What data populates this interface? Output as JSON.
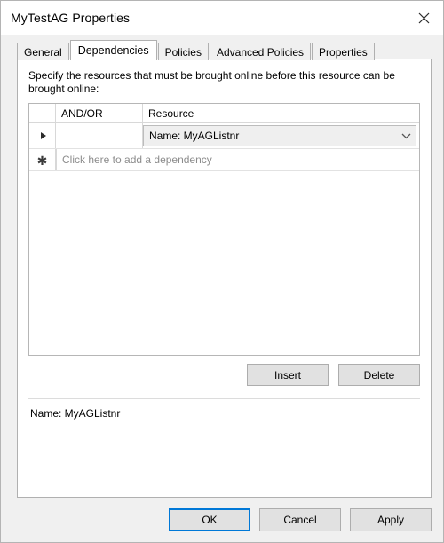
{
  "window": {
    "title": "MyTestAG Properties",
    "close_label": "✕"
  },
  "tabs": [
    {
      "label": "General",
      "active": false
    },
    {
      "label": "Dependencies",
      "active": true
    },
    {
      "label": "Policies",
      "active": false
    },
    {
      "label": "Advanced Policies",
      "active": false
    },
    {
      "label": "Properties",
      "active": false
    }
  ],
  "panel": {
    "instructions": "Specify the resources that must be brought online before this resource can be brought online:",
    "grid": {
      "columns": [
        "",
        "AND/OR",
        "Resource"
      ],
      "rows": [
        {
          "marker": "current-row",
          "and_or": "",
          "resource": "Name: MyAGListnr",
          "resource_is_combo": true
        }
      ],
      "new_row": {
        "marker": "new-row",
        "placeholder": "Click here to add a dependency"
      }
    },
    "buttons": {
      "insert": "Insert",
      "delete": "Delete"
    },
    "summary": "Name: MyAGListnr"
  },
  "footer": {
    "ok": "OK",
    "cancel": "Cancel",
    "apply": "Apply"
  },
  "colors": {
    "accent": "#0078d7",
    "dialog_bg": "#f0f0f0",
    "panel_bg": "#ffffff",
    "button_bg": "#e1e1e1",
    "combo_bg": "#efefef",
    "placeholder_text": "#8c8c8c"
  }
}
